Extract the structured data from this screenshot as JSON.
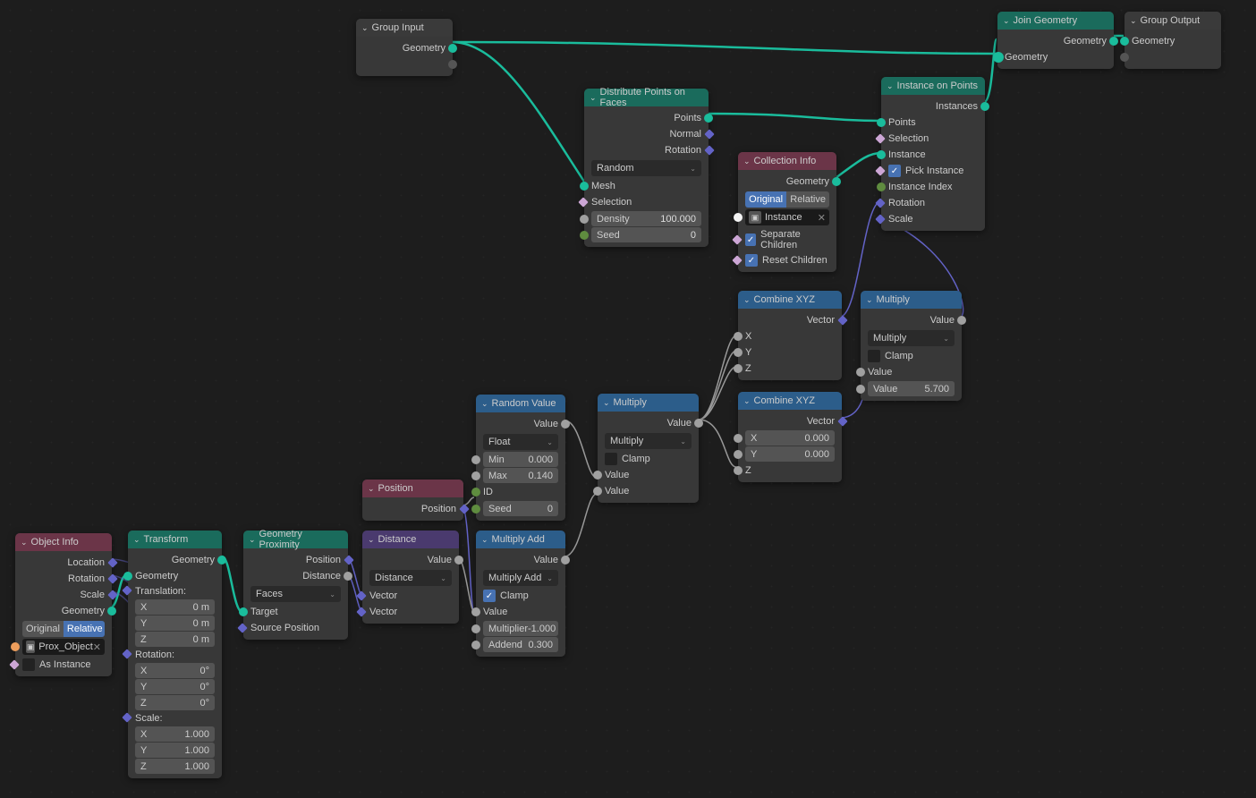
{
  "group_input": {
    "title": "Group Input",
    "out_geometry": "Geometry"
  },
  "group_output": {
    "title": "Group Output",
    "in_geometry": "Geometry"
  },
  "join_geometry": {
    "title": "Join Geometry",
    "out_geometry": "Geometry",
    "in_geometry": "Geometry"
  },
  "distribute_points": {
    "title": "Distribute Points on Faces",
    "out_points": "Points",
    "out_normal": "Normal",
    "out_rotation": "Rotation",
    "mode": "Random",
    "in_mesh": "Mesh",
    "in_selection": "Selection",
    "density_label": "Density",
    "density_value": "100.000",
    "seed_label": "Seed",
    "seed_value": "0"
  },
  "instance_on_points": {
    "title": "Instance on Points",
    "out_instances": "Instances",
    "in_points": "Points",
    "in_selection": "Selection",
    "in_instance": "Instance",
    "pick_instance": "Pick Instance",
    "in_instance_index": "Instance Index",
    "in_rotation": "Rotation",
    "in_scale": "Scale"
  },
  "collection_info": {
    "title": "Collection Info",
    "out_geometry": "Geometry",
    "btn_original": "Original",
    "btn_relative": "Relative",
    "collection": "Instance",
    "separate": "Separate Children",
    "reset": "Reset Children"
  },
  "object_info": {
    "title": "Object Info",
    "out_location": "Location",
    "out_rotation": "Rotation",
    "out_scale": "Scale",
    "out_geometry": "Geometry",
    "btn_original": "Original",
    "btn_relative": "Relative",
    "object": "Prox_Object",
    "as_instance": "As Instance"
  },
  "transform": {
    "title": "Transform",
    "out_geometry": "Geometry",
    "in_geometry": "Geometry",
    "translation": "Translation:",
    "rotation": "Rotation:",
    "scale": "Scale:",
    "tx": "0 m",
    "ty": "0 m",
    "tz": "0 m",
    "rx": "0°",
    "ry": "0°",
    "rz": "0°",
    "sx": "1.000",
    "sy": "1.000",
    "sz": "1.000",
    "x": "X",
    "y": "Y",
    "z": "Z"
  },
  "geometry_proximity": {
    "title": "Geometry Proximity",
    "out_position": "Position",
    "out_distance": "Distance",
    "mode": "Faces",
    "in_target": "Target",
    "in_source": "Source Position"
  },
  "position": {
    "title": "Position",
    "out_position": "Position"
  },
  "distance": {
    "title": "Distance",
    "out_value": "Value",
    "mode": "Distance",
    "in_vector1": "Vector",
    "in_vector2": "Vector"
  },
  "random_value": {
    "title": "Random Value",
    "out_value": "Value",
    "type": "Float",
    "min_label": "Min",
    "min_value": "0.000",
    "max_label": "Max",
    "max_value": "0.140",
    "in_id": "ID",
    "seed_label": "Seed",
    "seed_value": "0"
  },
  "multiply_add": {
    "title": "Multiply Add",
    "out_value": "Value",
    "mode": "Multiply Add",
    "clamp": "Clamp",
    "in_value": "Value",
    "multiplier_label": "Multiplier",
    "multiplier_value": "-1.000",
    "addend_label": "Addend",
    "addend_value": "0.300"
  },
  "multiply1": {
    "title": "Multiply",
    "out_value": "Value",
    "mode": "Multiply",
    "clamp": "Clamp",
    "in_value1": "Value",
    "in_value2": "Value"
  },
  "combine_xyz1": {
    "title": "Combine XYZ",
    "out_vector": "Vector",
    "x": "X",
    "y": "Y",
    "z": "Z"
  },
  "combine_xyz2": {
    "title": "Combine XYZ",
    "out_vector": "Vector",
    "x_label": "X",
    "x_value": "0.000",
    "y_label": "Y",
    "y_value": "0.000",
    "z": "Z"
  },
  "multiply2": {
    "title": "Multiply",
    "out_value": "Value",
    "mode": "Multiply",
    "clamp": "Clamp",
    "in_value": "Value",
    "value_label": "Value",
    "value_value": "5.700"
  }
}
